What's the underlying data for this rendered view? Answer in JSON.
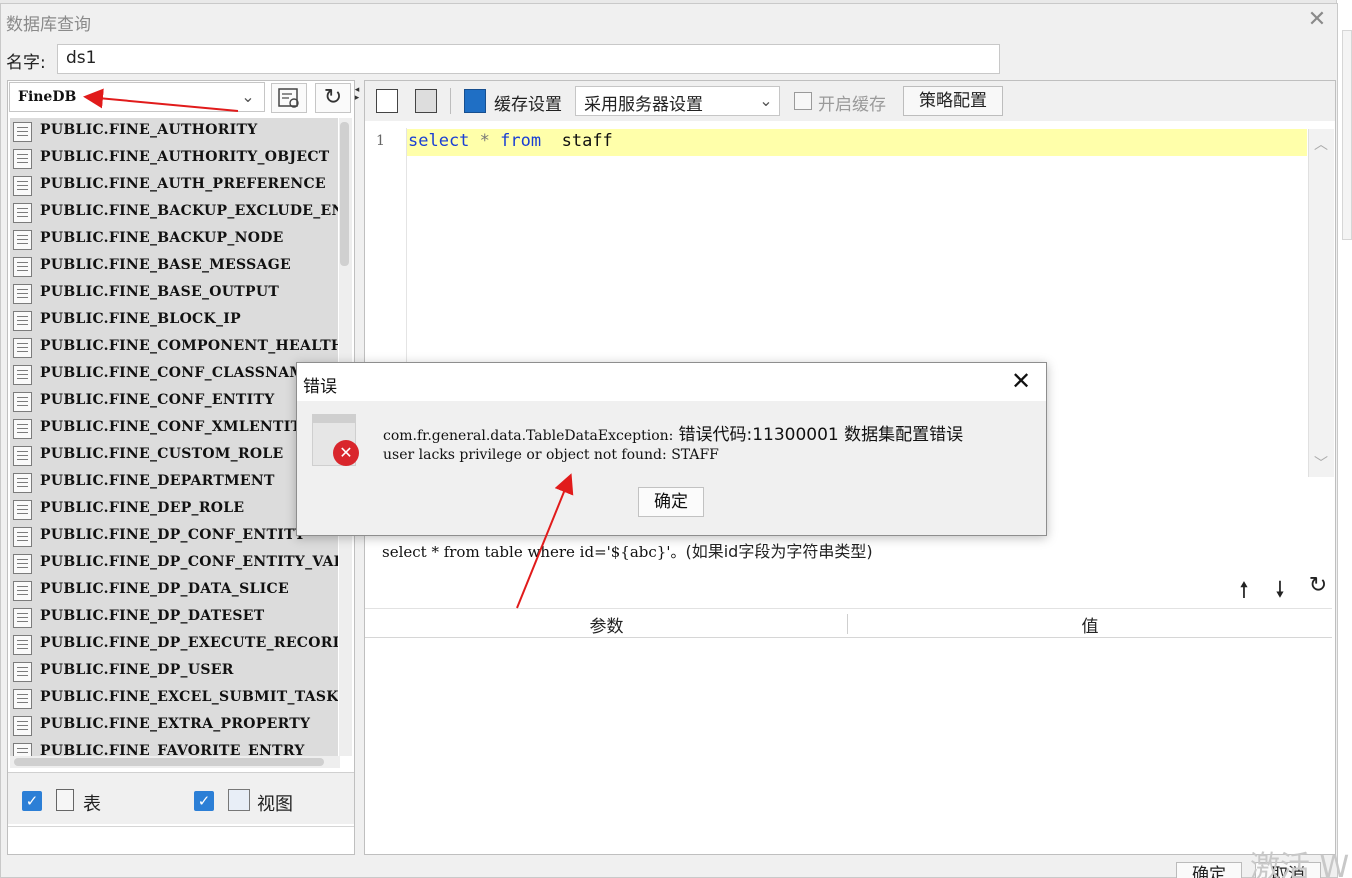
{
  "dialog": {
    "title": "数据库查询",
    "name_label": "名字:",
    "name_value": "ds1"
  },
  "left_panel": {
    "connection": "FineDB",
    "tables": [
      "PUBLIC.FINE_AUTHORITY",
      "PUBLIC.FINE_AUTHORITY_OBJECT",
      "PUBLIC.FINE_AUTH_PREFERENCE",
      "PUBLIC.FINE_BACKUP_EXCLUDE_ENTITY",
      "PUBLIC.FINE_BACKUP_NODE",
      "PUBLIC.FINE_BASE_MESSAGE",
      "PUBLIC.FINE_BASE_OUTPUT",
      "PUBLIC.FINE_BLOCK_IP",
      "PUBLIC.FINE_COMPONENT_HEALTH",
      "PUBLIC.FINE_CONF_CLASSNAME",
      "PUBLIC.FINE_CONF_ENTITY",
      "PUBLIC.FINE_CONF_XMLENTITY",
      "PUBLIC.FINE_CUSTOM_ROLE",
      "PUBLIC.FINE_DEPARTMENT",
      "PUBLIC.FINE_DEP_ROLE",
      "PUBLIC.FINE_DP_CONF_ENTITY",
      "PUBLIC.FINE_DP_CONF_ENTITY_VALUE",
      "PUBLIC.FINE_DP_DATA_SLICE",
      "PUBLIC.FINE_DP_DATESET",
      "PUBLIC.FINE_DP_EXECUTE_RECORD",
      "PUBLIC.FINE_DP_USER",
      "PUBLIC.FINE_EXCEL_SUBMIT_TASK",
      "PUBLIC.FINE_EXTRA_PROPERTY",
      "PUBLIC.FINE_FAVORITE_ENTRY"
    ],
    "filter_table": "表",
    "filter_view": "视图"
  },
  "toolbar": {
    "cache_label": "缓存设置",
    "cache_option": "采用服务器设置",
    "enable_cache": "开启缓存",
    "strategy": "策略配置"
  },
  "editor": {
    "line_number": "1",
    "sql_select": "select",
    "sql_star": "*",
    "sql_from": "from",
    "sql_table": "staff"
  },
  "hint": {
    "code": "select * from table where id='${abc}'。",
    "text": "(如果id字段为字符串类型)"
  },
  "params": {
    "col_param": "参数",
    "col_value": "值"
  },
  "footer": {
    "ok": "确定",
    "cancel": "取消",
    "watermark": "激活 W"
  },
  "error": {
    "title": "错误",
    "line1_code": "com.fr.general.data.TableDataException:",
    "line1_msg": "错误代码:11300001 数据集配置错误",
    "line2": "user lacks privilege or object not found: STAFF",
    "ok": "确定"
  },
  "colors": {
    "accent": "#2c7fd6",
    "keyword": "#1a3fd4",
    "error_red": "#d9262c",
    "annotation": "#e11b1b",
    "highlight": "#ffffaa"
  }
}
